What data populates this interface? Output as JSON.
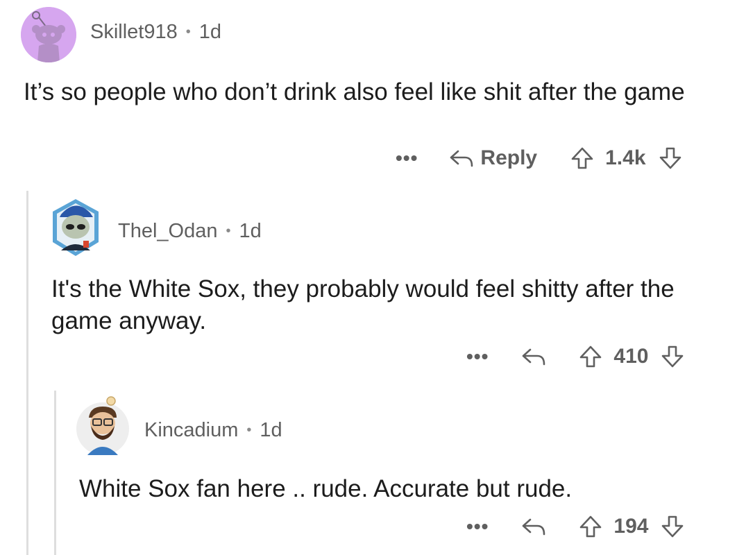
{
  "comments": [
    {
      "username": "Skillet918",
      "separator": "•",
      "age": "1d",
      "body": "It’s so people who don’t drink also feel like shit after the game",
      "more": "•••",
      "reply_label": "Reply",
      "score": "1.4k",
      "avatar_icon": "reddit-snoo-avatar-icon",
      "avatar_bg": "#d6a6ef"
    },
    {
      "username": "Thel_Odan",
      "separator": "•",
      "age": "1d",
      "body": "It's the White Sox, they probably would feel shitty after the game anyway.",
      "more": "•••",
      "score": "410",
      "avatar_icon": "alien-avatar-icon",
      "avatar_bg": "#5aa4d6"
    },
    {
      "username": "Kincadium",
      "separator": "•",
      "age": "1d",
      "body": "White Sox fan here .. rude.  Accurate but rude.",
      "more": "•••",
      "score": "194",
      "avatar_icon": "bearded-avatar-icon",
      "avatar_bg": "#eeeeee"
    }
  ]
}
